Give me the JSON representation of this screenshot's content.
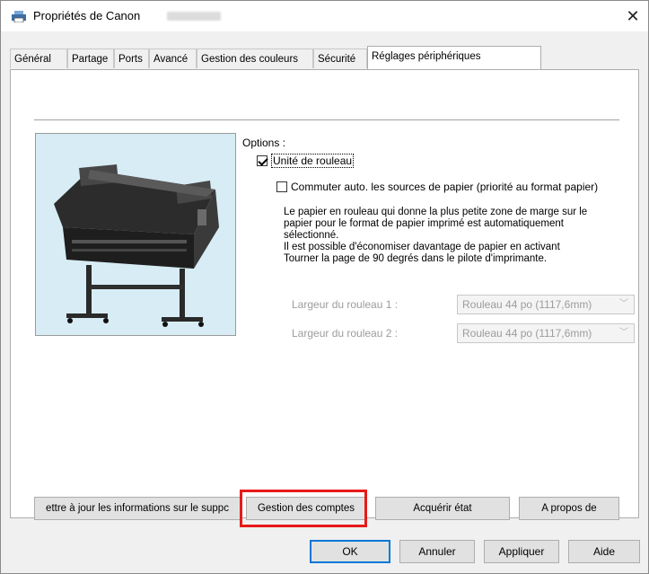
{
  "window": {
    "title": "Propriétés de Canon",
    "close": "✕"
  },
  "tabs": [
    {
      "label": "Général"
    },
    {
      "label": "Partage"
    },
    {
      "label": "Ports"
    },
    {
      "label": "Avancé"
    },
    {
      "label": "Gestion des couleurs"
    },
    {
      "label": "Sécurité"
    },
    {
      "label": "Réglages périphériques",
      "active": true
    }
  ],
  "options": {
    "label": "Options :",
    "roll_unit": {
      "label": "Unité de rouleau",
      "checked": true
    },
    "auto_switch": {
      "label": "Commuter auto. les sources de papier (priorité au format papier)",
      "checked": false
    },
    "description": "Le papier en rouleau qui donne la plus petite zone de marge sur le\npapier pour le format de papier imprimé est automatiquement\nsélectionné.\nIl est possible d'économiser davantage de papier en activant\nTourner la page de 90 degrés dans le pilote d'imprimante.",
    "roll_width_1": {
      "label": "Largeur du rouleau 1 :",
      "value": "Rouleau 44 po (1117,6mm)"
    },
    "roll_width_2": {
      "label": "Largeur du rouleau 2 :",
      "value": "Rouleau 44 po (1117,6mm)"
    }
  },
  "panel_buttons": {
    "update": "ettre à jour les informations sur le suppc",
    "accounts": "Gestion des comptes",
    "status": "Acquérir état",
    "about": "A propos de"
  },
  "dialog_buttons": {
    "ok": "OK",
    "cancel": "Annuler",
    "apply": "Appliquer",
    "help": "Aide"
  },
  "colors": {
    "highlight": "#e81a1a",
    "default_button": "#0078d7",
    "preview_bg": "#d7ecf5"
  }
}
